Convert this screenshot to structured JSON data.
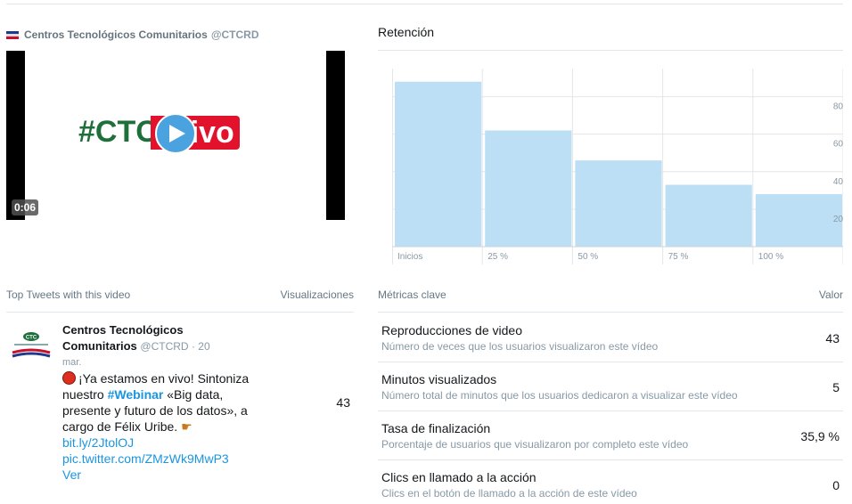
{
  "video": {
    "account_name": "Centros Tecnológicos Comunitarios",
    "account_handle": "@CTCRD",
    "brand_left": "#CTC",
    "brand_right": "vivo",
    "duration": "0:06"
  },
  "retention": {
    "title": "Retención"
  },
  "chart_data": {
    "type": "bar",
    "categories": [
      "Inicios",
      "25 %",
      "50 %",
      "75 %",
      "100 %"
    ],
    "values": [
      88,
      62,
      46,
      33,
      28
    ],
    "yticks": [
      20,
      40,
      60,
      80
    ],
    "ylim": [
      0,
      95
    ],
    "grid": true,
    "bar_color": "#bcdff5"
  },
  "top_tweets": {
    "header_label": "Top Tweets with this video",
    "header_views": "Visualizaciones",
    "tweet": {
      "author": "Centros Tecnológicos Comunitarios",
      "handle": "@CTCRD",
      "date_sep": " · 20",
      "date_rest": "mar.",
      "text_1": "¡Ya estamos en vivo! Sintoniza nuestro ",
      "hashtag": "#Webinar",
      "text_2": " «Big data, presente y futuro de los datos», a cargo de Félix Uribe. ",
      "link_1": "bit.ly/2JtolOJ",
      "link_2": "pic.twitter.com/ZMzWk9MwP3",
      "more": "Ver",
      "views": "43"
    }
  },
  "key_metrics": {
    "header_label": "Métricas clave",
    "header_value": "Valor",
    "items": [
      {
        "name": "Reproducciones de video",
        "desc": "Número de veces que los usuarios visualizaron este vídeo",
        "value": "43"
      },
      {
        "name": "Minutos visualizados",
        "desc": "Número total de minutos que los usuarios dedicaron a visualizar este vídeo",
        "value": "5"
      },
      {
        "name": "Tasa de finalización",
        "desc": "Porcentaje de usuarios que visualizaron por completo este vídeo",
        "value": "35,9 %"
      },
      {
        "name": "Clics en llamado a la acción",
        "desc": "Clics en el botón de llamado a la acción de este vídeo",
        "value": "0"
      }
    ]
  },
  "colors": {
    "brand_green": "#1e6f3a",
    "brand_red": "#e2112c",
    "link_blue": "#1b95e0",
    "chart_bar": "#bcdff5"
  }
}
